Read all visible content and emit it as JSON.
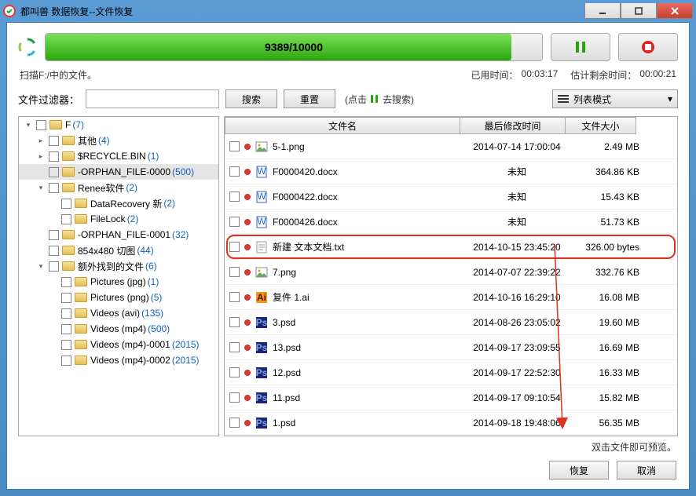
{
  "window": {
    "title": "都叫兽 数据恢复--文件恢复"
  },
  "progress": {
    "text": "9389/10000",
    "percent": 93.89
  },
  "status": {
    "scanning": "扫描F:/中的文件。",
    "elapsed_label": "已用时间：",
    "elapsed_value": "00:03:17",
    "remain_label": "估计剩余时间：",
    "remain_value": "00:00:21"
  },
  "filter": {
    "label": "文件过滤器：",
    "search": "搜索",
    "reset": "重置",
    "hint_prefix": "(点击",
    "hint_suffix": "去搜索)"
  },
  "viewmode": {
    "label": "列表模式"
  },
  "tree": [
    {
      "depth": 0,
      "expand": "▾",
      "name": "F",
      "count": "(7)"
    },
    {
      "depth": 1,
      "expand": "▸",
      "name": "其他",
      "count": "(4)"
    },
    {
      "depth": 1,
      "expand": "▸",
      "name": "$RECYCLE.BIN",
      "count": "(1)"
    },
    {
      "depth": 1,
      "expand": "",
      "name": "-ORPHAN_FILE-0000",
      "count": "(500)",
      "sel": true
    },
    {
      "depth": 1,
      "expand": "▾",
      "name": "Renee软件",
      "count": "(2)"
    },
    {
      "depth": 2,
      "expand": "",
      "name": "DataRecovery 新",
      "count": "(2)"
    },
    {
      "depth": 2,
      "expand": "",
      "name": "FileLock",
      "count": "(2)"
    },
    {
      "depth": 1,
      "expand": "",
      "name": "-ORPHAN_FILE-0001",
      "count": "(32)"
    },
    {
      "depth": 1,
      "expand": "",
      "name": "854x480 切图",
      "count": "(44)"
    },
    {
      "depth": 1,
      "expand": "▾",
      "name": "额外找到的文件",
      "count": "(6)"
    },
    {
      "depth": 2,
      "expand": "",
      "name": "Pictures (jpg)",
      "count": "(1)"
    },
    {
      "depth": 2,
      "expand": "",
      "name": "Pictures (png)",
      "count": "(5)"
    },
    {
      "depth": 2,
      "expand": "",
      "name": "Videos (avi)",
      "count": "(135)"
    },
    {
      "depth": 2,
      "expand": "",
      "name": "Videos (mp4)",
      "count": "(500)"
    },
    {
      "depth": 2,
      "expand": "",
      "name": "Videos (mp4)-0001",
      "count": "(2015)"
    },
    {
      "depth": 2,
      "expand": "",
      "name": "Videos (mp4)-0002",
      "count": "(2015)"
    }
  ],
  "columns": {
    "name": "文件名",
    "date": "最后修改时间",
    "size": "文件大小"
  },
  "files": [
    {
      "icon": "img",
      "name": "5-1.png",
      "date": "2014-07-14 17:00:04",
      "size": "2.49 MB"
    },
    {
      "icon": "doc",
      "name": "F0000420.docx",
      "date": "未知",
      "size": "364.86 KB"
    },
    {
      "icon": "doc",
      "name": "F0000422.docx",
      "date": "未知",
      "size": "15.43 KB"
    },
    {
      "icon": "doc",
      "name": "F0000426.docx",
      "date": "未知",
      "size": "51.73 KB"
    },
    {
      "icon": "txt",
      "name": "新建 文本文档.txt",
      "date": "2014-10-15 23:45:20",
      "size": "326.00 bytes",
      "hl": true
    },
    {
      "icon": "img",
      "name": "7.png",
      "date": "2014-07-07 22:39:22",
      "size": "332.76 KB"
    },
    {
      "icon": "ai",
      "name": "复件 1.ai",
      "date": "2014-10-16 16:29:10",
      "size": "16.08 MB"
    },
    {
      "icon": "psd",
      "name": "3.psd",
      "date": "2014-08-26 23:05:02",
      "size": "19.60 MB"
    },
    {
      "icon": "psd",
      "name": "13.psd",
      "date": "2014-09-17 23:09:55",
      "size": "16.69 MB"
    },
    {
      "icon": "psd",
      "name": "12.psd",
      "date": "2014-09-17 22:52:30",
      "size": "16.33 MB"
    },
    {
      "icon": "psd",
      "name": "11.psd",
      "date": "2014-09-17 09:10:54",
      "size": "15.82 MB"
    },
    {
      "icon": "psd",
      "name": "1.psd",
      "date": "2014-09-18 19:48:06",
      "size": "56.35 MB"
    }
  ],
  "preview_hint": "双击文件即可预览。",
  "footer": {
    "recover": "恢复",
    "cancel": "取消"
  }
}
